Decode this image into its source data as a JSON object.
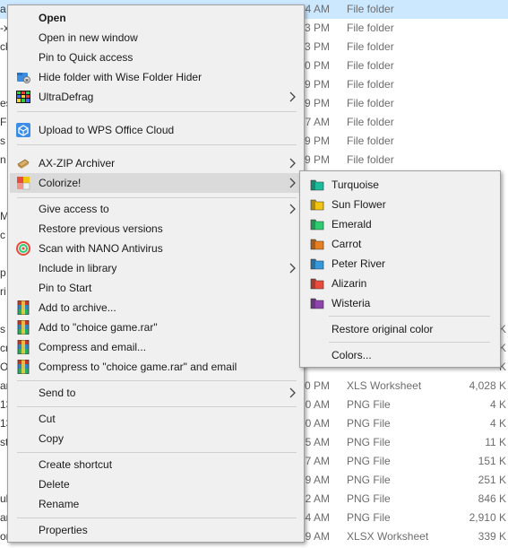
{
  "background_files": [
    {
      "lead": "a",
      "time": "4 AM",
      "type": "File folder",
      "size": ""
    },
    {
      "lead": "-x",
      "time": "3 PM",
      "type": "File folder",
      "size": ""
    },
    {
      "lead": "ck",
      "time": "3 PM",
      "type": "File folder",
      "size": ""
    },
    {
      "lead": "",
      "time": "0 PM",
      "type": "File folder",
      "size": ""
    },
    {
      "lead": "",
      "time": "9 PM",
      "type": "File folder",
      "size": ""
    },
    {
      "lead": "es",
      "time": "9 PM",
      "type": "File folder",
      "size": ""
    },
    {
      "lead": "F",
      "time": "7 AM",
      "type": "File folder",
      "size": ""
    },
    {
      "lead": "s",
      "time": "9 PM",
      "type": "File folder",
      "size": ""
    },
    {
      "lead": "n",
      "time": "9 PM",
      "type": "File folder",
      "size": ""
    },
    {
      "lead": "",
      "time": "",
      "type": "",
      "size": ""
    },
    {
      "lead": "",
      "time": "",
      "type": "",
      "size": ""
    },
    {
      "lead": "M",
      "time": "",
      "type": "",
      "size": ""
    },
    {
      "lead": "c",
      "time": "",
      "type": "",
      "size": ""
    },
    {
      "lead": "",
      "time": "",
      "type": "",
      "size": ""
    },
    {
      "lead": "p",
      "time": "",
      "type": "",
      "size": ""
    },
    {
      "lead": "ri",
      "time": "",
      "type": "",
      "size": ""
    },
    {
      "lead": "",
      "time": "",
      "type": "",
      "size": ""
    },
    {
      "lead": "s",
      "time": "",
      "type": "",
      "size": "K"
    },
    {
      "lead": "cr",
      "time": "",
      "type": "",
      "size": "K"
    },
    {
      "lead": "O",
      "time": "",
      "type": "",
      "size": "K"
    },
    {
      "lead": "ar",
      "time": "0 PM",
      "type": "XLS Worksheet",
      "size": "4,028 K"
    },
    {
      "lead": "13",
      "time": "0 AM",
      "type": "PNG File",
      "size": "4 K"
    },
    {
      "lead": "13",
      "time": "0 AM",
      "type": "PNG File",
      "size": "4 K"
    },
    {
      "lead": "st",
      "time": "5 AM",
      "type": "PNG File",
      "size": "11 K"
    },
    {
      "lead": "",
      "time": "7 AM",
      "type": "PNG File",
      "size": "151 K"
    },
    {
      "lead": "",
      "time": "9 AM",
      "type": "PNG File",
      "size": "251 K"
    },
    {
      "lead": "ub",
      "time": "52 AM",
      "type": "PNG File",
      "size": "846 K"
    },
    {
      "lead": "ar",
      "time": "54 AM",
      "type": "PNG File",
      "size": "2,910 K"
    },
    {
      "lead": "ort",
      "time": "9 AM",
      "type": "XLSX Worksheet",
      "size": "339 K"
    }
  ],
  "context_menu": {
    "open": "Open",
    "open_new_window": "Open in new window",
    "pin_quick_access": "Pin to Quick access",
    "hide_folder": "Hide folder with Wise Folder Hider",
    "ultradefrag": "UltraDefrag",
    "upload_wps": "Upload to WPS Office Cloud",
    "ax_zip": "AX-ZIP Archiver",
    "colorize": "Colorize!",
    "give_access": "Give access to",
    "restore_versions": "Restore previous versions",
    "scan_nano": "Scan with NANO Antivirus",
    "include_library": "Include in library",
    "pin_start": "Pin to Start",
    "add_archive": "Add to archive...",
    "add_choice_rar": "Add to \"choice game.rar\"",
    "compress_email": "Compress and email...",
    "compress_choice_email": "Compress to \"choice game.rar\" and email",
    "send_to": "Send to",
    "cut": "Cut",
    "copy": "Copy",
    "create_shortcut": "Create shortcut",
    "delete": "Delete",
    "rename": "Rename",
    "properties": "Properties"
  },
  "colorize_submenu": {
    "colors": [
      {
        "label": "Turquoise",
        "color": "#1abc9c"
      },
      {
        "label": "Sun Flower",
        "color": "#f1c40f"
      },
      {
        "label": "Emerald",
        "color": "#2ecc71"
      },
      {
        "label": "Carrot",
        "color": "#e67e22"
      },
      {
        "label": "Peter River",
        "color": "#3498db"
      },
      {
        "label": "Alizarin",
        "color": "#e74c3c"
      },
      {
        "label": "Wisteria",
        "color": "#8e44ad"
      }
    ],
    "restore": "Restore original color",
    "colors_dialog": "Colors..."
  },
  "theme": {
    "selection_bg": "#cce8ff",
    "menu_bg": "#f0f0f0",
    "hover_bg": "#dadada",
    "winrar_icon": "winrar-icon",
    "wps_icon": "wps-cloud-icon"
  }
}
